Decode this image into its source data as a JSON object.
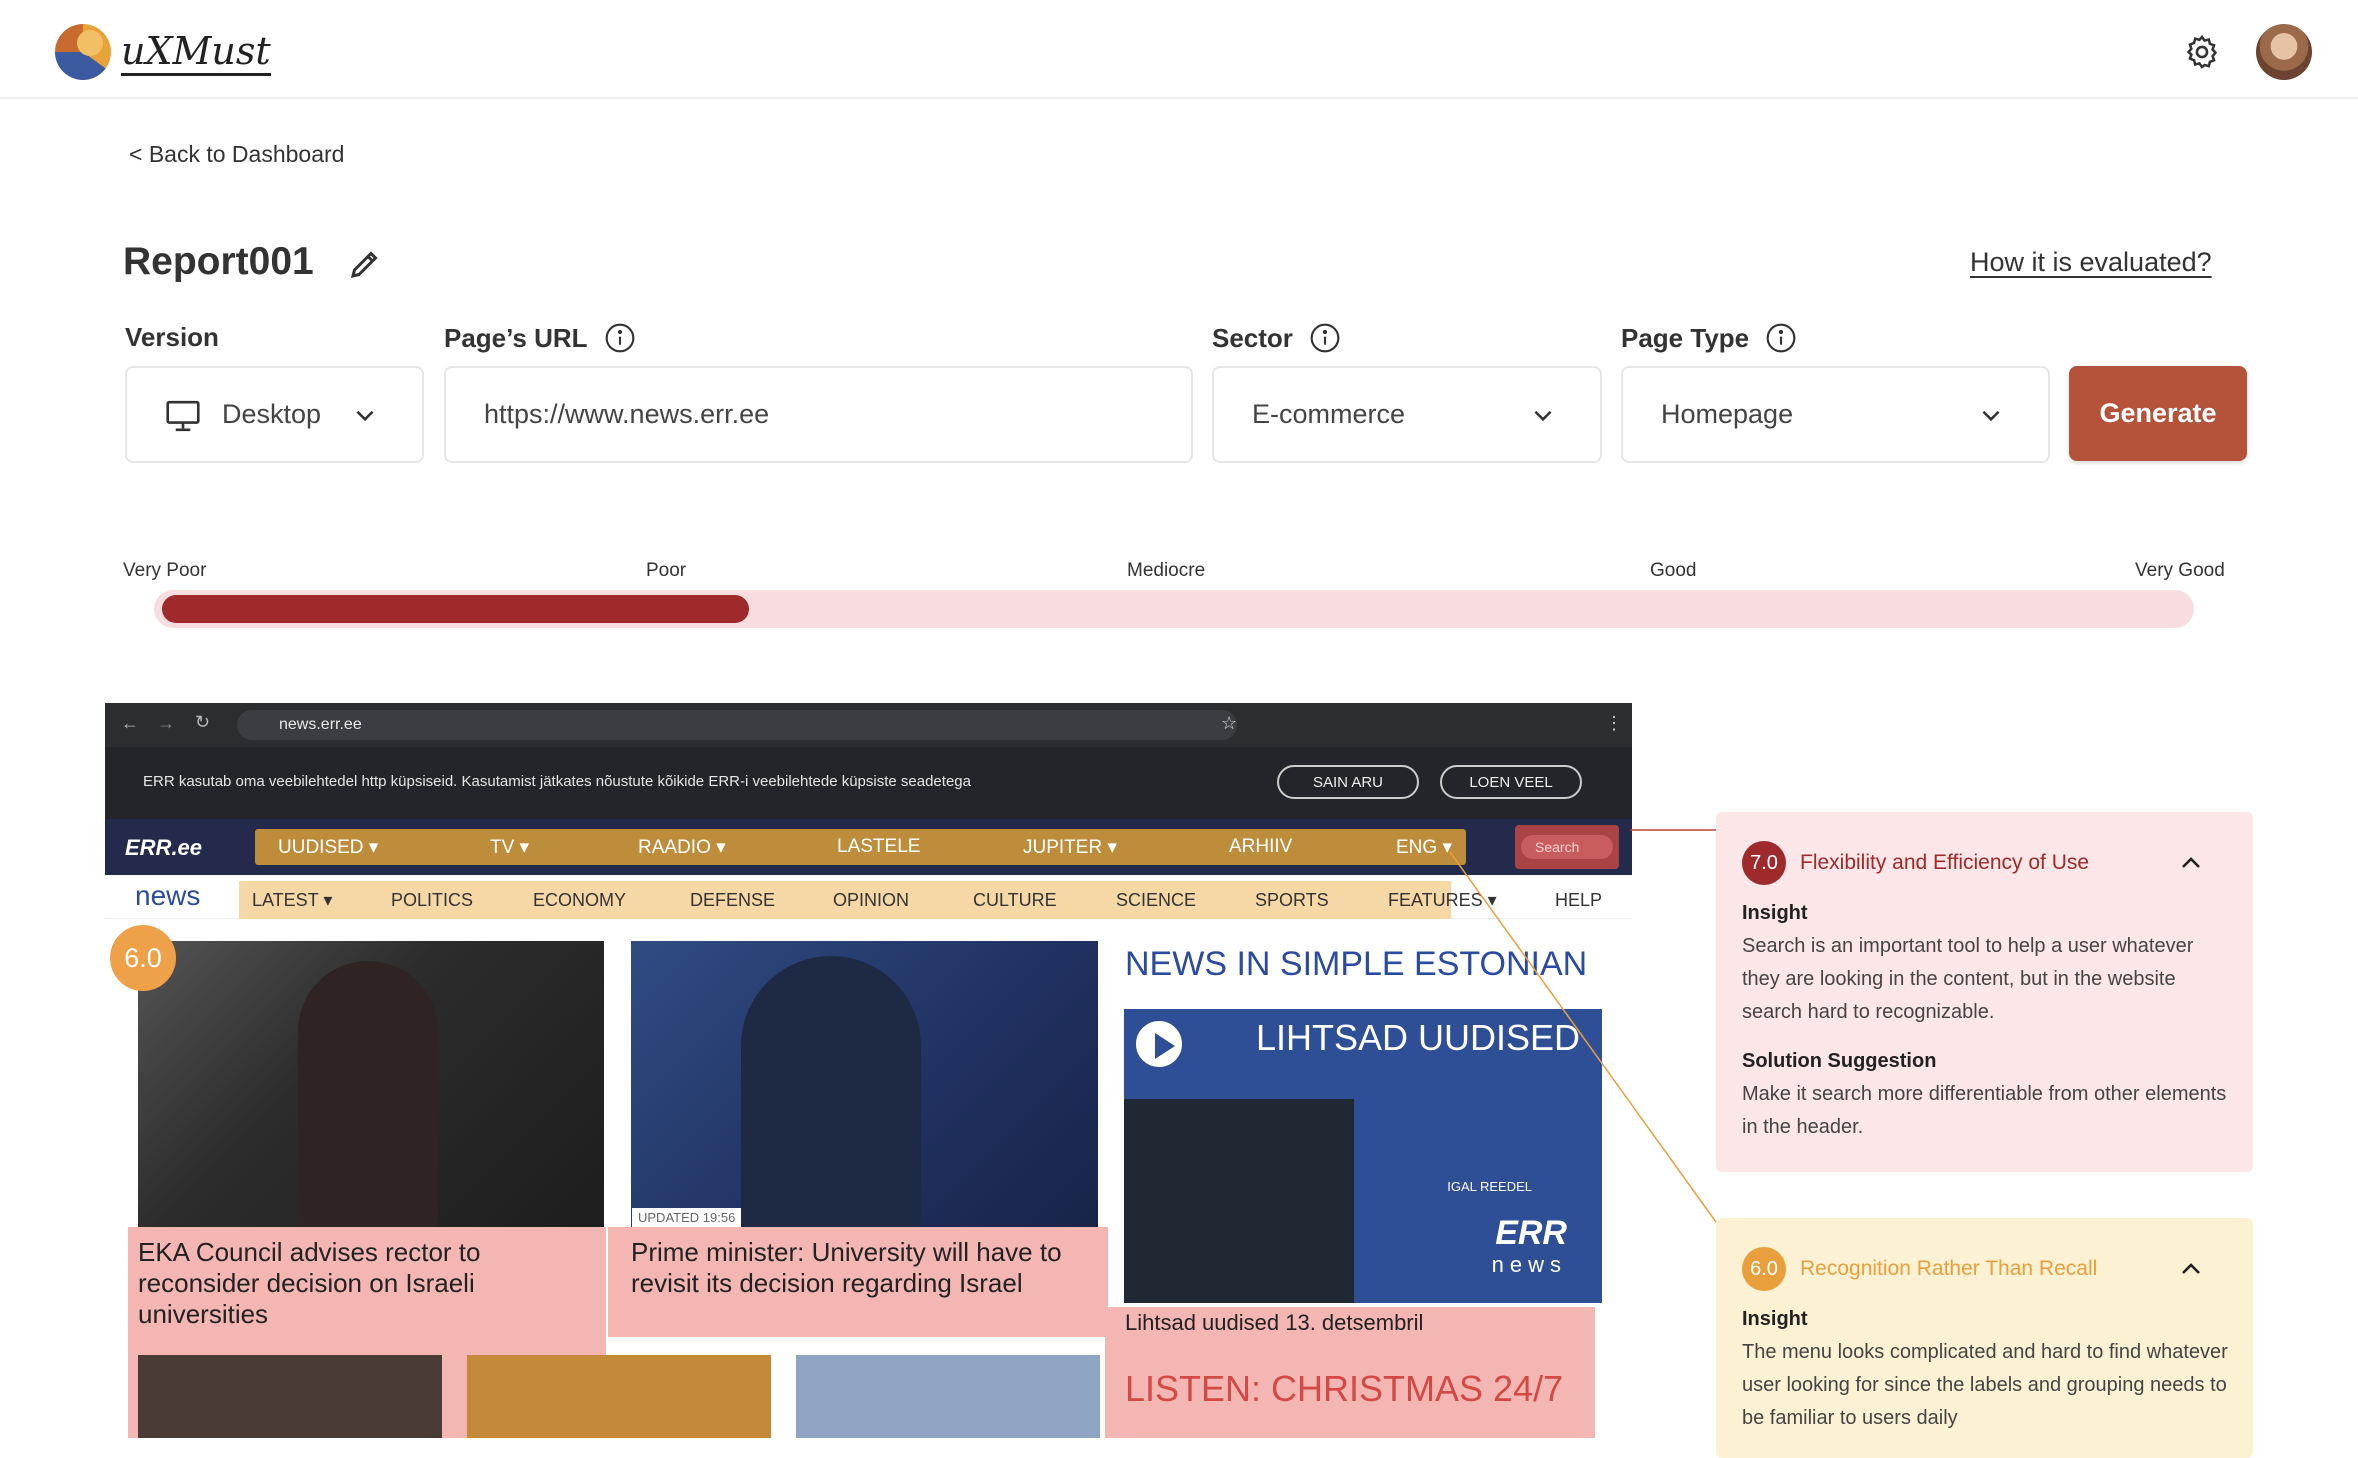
{
  "app": {
    "logo_text": "uXMust"
  },
  "nav": {
    "back_label": "< Back to Dashboard"
  },
  "report": {
    "title": "Report001",
    "how_link": "How it is evaluated?"
  },
  "form": {
    "version_label": "Version",
    "version_value": "Desktop",
    "url_label": "Page’s URL",
    "url_value": "https://www.news.err.ee",
    "sector_label": "Sector",
    "sector_value": "E-commerce",
    "pagetype_label": "Page Type",
    "pagetype_value": "Homepage",
    "generate_label": "Generate"
  },
  "rating": {
    "labels": [
      "Very Poor",
      "Poor",
      "Mediocre",
      "Good",
      "Very Good"
    ],
    "level_fraction": 0.29,
    "bar_color": "#9e2a2b",
    "track_color": "#f7dde0"
  },
  "screenshot": {
    "browser_url": "news.err.ee",
    "cookie_text": "ERR kasutab oma veebilehtedel http küpsiseid. Kasutamist jätkates nõustute kõikide ERR-i veebilehtede küpsiste seadetega",
    "cookie_btn1": "SAIN ARU",
    "cookie_btn2": "LOEN VEEL",
    "err_logo": "ERR.ee",
    "err_menu": [
      "UUDISED ▾",
      "TV ▾",
      "RAADIO ▾",
      "LASTELE",
      "JUPITER ▾",
      "ARHIIV",
      "ENG ▾"
    ],
    "search_placeholder": "Search",
    "news_logo": "news",
    "sub_menu": [
      "LATEST ▾",
      "POLITICS",
      "ECONOMY",
      "DEFENSE",
      "OPINION",
      "CULTURE",
      "SCIENCE",
      "SPORTS",
      "FEATURES ▾",
      "HELP"
    ],
    "score_badge": "6.0",
    "updated": "UPDATED 19:56",
    "headline1": "EKA Council advises rector to reconsider decision on Israeli universities",
    "headline2": "Prime minister: University will have to revisit its decision regarding Israel",
    "simple_title": "NEWS IN SIMPLE ESTONIAN",
    "video_title": "LIHTSAD UUDISED",
    "video_author": "IGAL REEDEL",
    "video_logo": "ERR",
    "video_sub": "news",
    "caption": "Lihtsad uudised 13. detsembril",
    "listen": "LISTEN: CHRISTMAS 24/7"
  },
  "cards": [
    {
      "score": "7.0",
      "title": "Flexibility and Efficiency of Use",
      "insight_label": "Insight",
      "insight": "Search is an important tool to help a user whatever they are looking in the content, but in the website search hard to recognizable.",
      "solution_label": "Solution Suggestion",
      "solution": "Make it search more differentiable from other elements in the header.",
      "color": "#9e2a2b"
    },
    {
      "score": "6.0",
      "title": "Recognition Rather Than Recall",
      "insight_label": "Insight",
      "insight": "The menu looks complicated and hard to find whatever user looking for since the labels and grouping needs to be familiar to users daily",
      "color": "#e9a03c"
    }
  ]
}
